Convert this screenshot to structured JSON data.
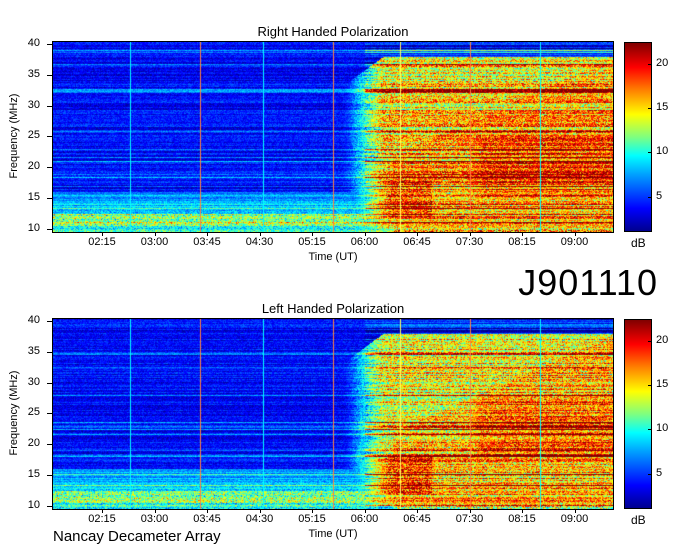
{
  "page_label": "J901110",
  "footer": "Nancay Decameter Array",
  "chart_data": [
    {
      "type": "heatmap",
      "title": "Right Handed Polarization",
      "xlabel": "Time (UT)",
      "ylabel": "Frequency (MHz)",
      "x_tick_labels": [
        "02:15",
        "03:00",
        "03:45",
        "04:30",
        "05:15",
        "06:00",
        "06:45",
        "07:30",
        "08:15",
        "09:00"
      ],
      "x_tick_hours": [
        2.25,
        3.0,
        3.75,
        4.5,
        5.25,
        6.0,
        6.75,
        7.5,
        8.25,
        9.0
      ],
      "xlim_hours": [
        1.55,
        9.55
      ],
      "y_ticks": [
        10,
        15,
        20,
        25,
        30,
        35,
        40
      ],
      "ylim": [
        9.5,
        40.3
      ],
      "colorbar": {
        "unit": "dB",
        "ticks": [
          5,
          10,
          15,
          20
        ],
        "range": [
          1,
          22.5
        ],
        "colormap": "jet"
      },
      "marker_lines_hours": [
        2.65,
        3.65,
        4.55,
        5.55,
        6.5,
        7.5,
        8.5
      ],
      "marker_colors": [
        "#00ffff",
        "#ff8040",
        "#00ffff",
        "#ff8040",
        "#ffff60",
        "#ff8040",
        "#00ffff"
      ],
      "description_points": [
        {
          "time_start": 5.6,
          "time_end": 9.55,
          "freq_low": 10,
          "freq_high": 38,
          "intensity_dB": 18
        },
        {
          "time_start": 5.7,
          "time_end": 6.95,
          "freq_low": 12,
          "freq_high": 18,
          "intensity_dB": 22
        },
        {
          "time_start": 7.0,
          "time_end": 9.55,
          "freq_low": 15,
          "freq_high": 25,
          "intensity_dB": 21
        }
      ]
    },
    {
      "type": "heatmap",
      "title": "Left Handed Polarization",
      "xlabel": "Time (UT)",
      "ylabel": "Frequency (MHz)",
      "x_tick_labels": [
        "02:15",
        "03:00",
        "03:45",
        "04:30",
        "05:15",
        "06:00",
        "06:45",
        "07:30",
        "08:15",
        "09:00"
      ],
      "x_tick_hours": [
        2.25,
        3.0,
        3.75,
        4.5,
        5.25,
        6.0,
        6.75,
        7.5,
        8.25,
        9.0
      ],
      "xlim_hours": [
        1.55,
        9.55
      ],
      "y_ticks": [
        10,
        15,
        20,
        25,
        30,
        35,
        40
      ],
      "ylim": [
        9.5,
        40.3
      ],
      "colorbar": {
        "unit": "dB",
        "ticks": [
          5,
          10,
          15,
          20
        ],
        "range": [
          1,
          22.5
        ],
        "colormap": "jet"
      },
      "marker_lines_hours": [
        2.65,
        3.65,
        4.55,
        5.55,
        6.5,
        7.5,
        8.5
      ],
      "marker_colors": [
        "#00ffff",
        "#ff8040",
        "#00ffff",
        "#ff8040",
        "#ffff60",
        "#ff8040",
        "#00ffff"
      ],
      "description_points": [
        {
          "time_start": 5.6,
          "time_end": 9.55,
          "freq_low": 10,
          "freq_high": 38,
          "intensity_dB": 17
        },
        {
          "time_start": 5.7,
          "time_end": 6.95,
          "freq_low": 12,
          "freq_high": 18,
          "intensity_dB": 22
        },
        {
          "time_start": 7.0,
          "time_end": 9.55,
          "freq_low": 18,
          "freq_high": 28,
          "intensity_dB": 21
        }
      ]
    }
  ]
}
